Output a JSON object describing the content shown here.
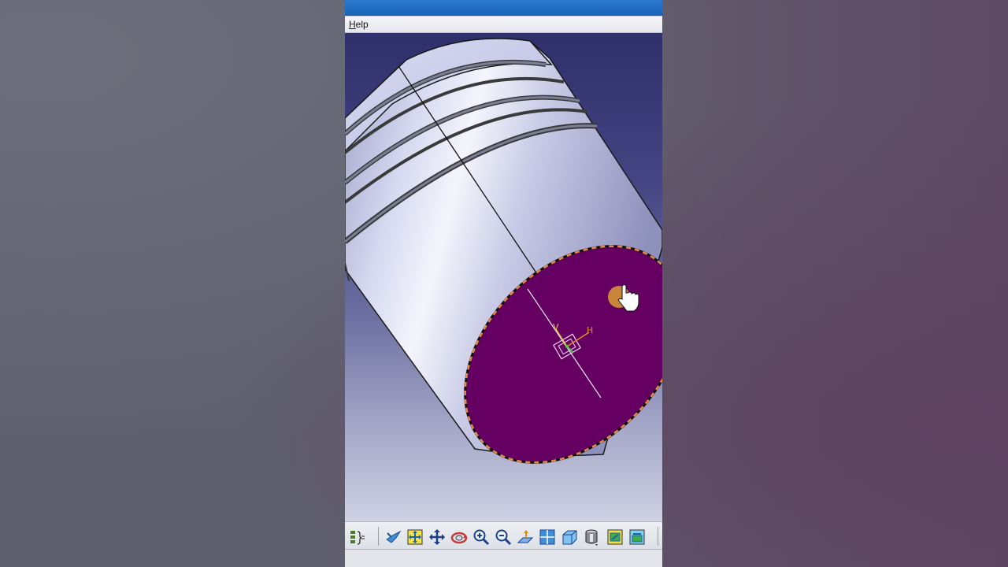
{
  "menu": {
    "help_label": "Help"
  },
  "viewport": {
    "sketch_axis_h": "H",
    "sketch_axis_v": "V",
    "colors": {
      "background_top": "#2f2f6b",
      "background_bottom": "#cfd2e3",
      "selected_face": "#650062",
      "selection_edge": "#e88a4c",
      "part_body": "#c9cbe6",
      "cursor_highlight": "#c9853a"
    }
  },
  "toolbar": {
    "icons": [
      "specification-tree-icon",
      "fly-mode-icon",
      "fit-all-in-icon",
      "pan-icon",
      "rotate-icon",
      "zoom-in-icon",
      "zoom-out-icon",
      "normal-view-icon",
      "multi-view-icon",
      "isometric-view-icon",
      "shading-mode-icon",
      "hide-show-icon",
      "swap-visible-space-icon"
    ]
  }
}
